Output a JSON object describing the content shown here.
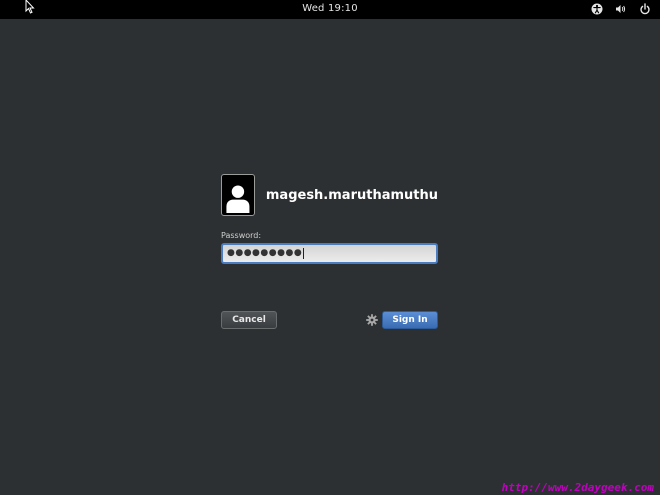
{
  "topbar": {
    "clock": "Wed 19:10",
    "icons": [
      "accessibility-icon",
      "volume-icon",
      "power-icon"
    ]
  },
  "login": {
    "username": "magesh.maruthamuthu",
    "password_label": "Password:",
    "password_value": "●●●●●●●●●",
    "cancel_label": "Cancel",
    "signin_label": "Sign In",
    "settings_icon": "gear-icon"
  },
  "watermark": "http://www.2daygeek.com",
  "colors": {
    "background": "#2d3032",
    "topbar": "#000000",
    "accent": "#4a7cbf",
    "watermark": "#c000c0"
  }
}
